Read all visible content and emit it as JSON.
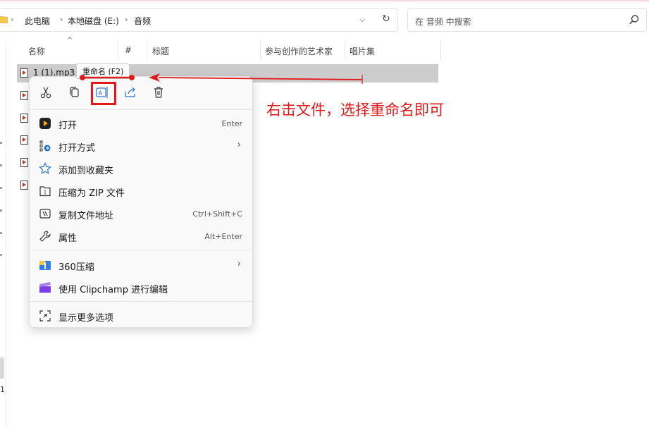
{
  "address": {
    "crumbs": [
      "此电脑",
      "本地磁盘 (E:)",
      "音频"
    ],
    "sep": "›"
  },
  "search": {
    "placeholder": "在 音频 中搜索"
  },
  "columns": [
    "名称",
    "#",
    "标题",
    "参与创作的艺术家",
    "唱片集"
  ],
  "files": [
    {
      "name": "1 (1).mp3"
    }
  ],
  "tooltip": "重命名 (F2)",
  "menu": {
    "toolbar": [
      "cut-icon",
      "copy-icon",
      "rename-icon",
      "share-icon",
      "delete-icon"
    ],
    "items": [
      {
        "label": "打开",
        "shortcut": "Enter"
      },
      {
        "label": "打开方式",
        "arrow": "›"
      },
      {
        "label": "添加到收藏夹"
      },
      {
        "label": "压缩为 ZIP 文件"
      },
      {
        "label": "复制文件地址",
        "shortcut": "Ctrl+Shift+C"
      },
      {
        "label": "属性",
        "shortcut": "Alt+Enter"
      },
      {
        "label": "360压缩",
        "arrow": "›"
      },
      {
        "label": "使用 Clipchamp 进行编辑"
      },
      {
        "label": "显示更多选项"
      }
    ]
  },
  "annotation": "右击文件，选择重命名即可",
  "nav": {
    "sel_label": "1"
  },
  "colors": {
    "accent_red": "#e01a1a",
    "selection": "#cccccc"
  }
}
